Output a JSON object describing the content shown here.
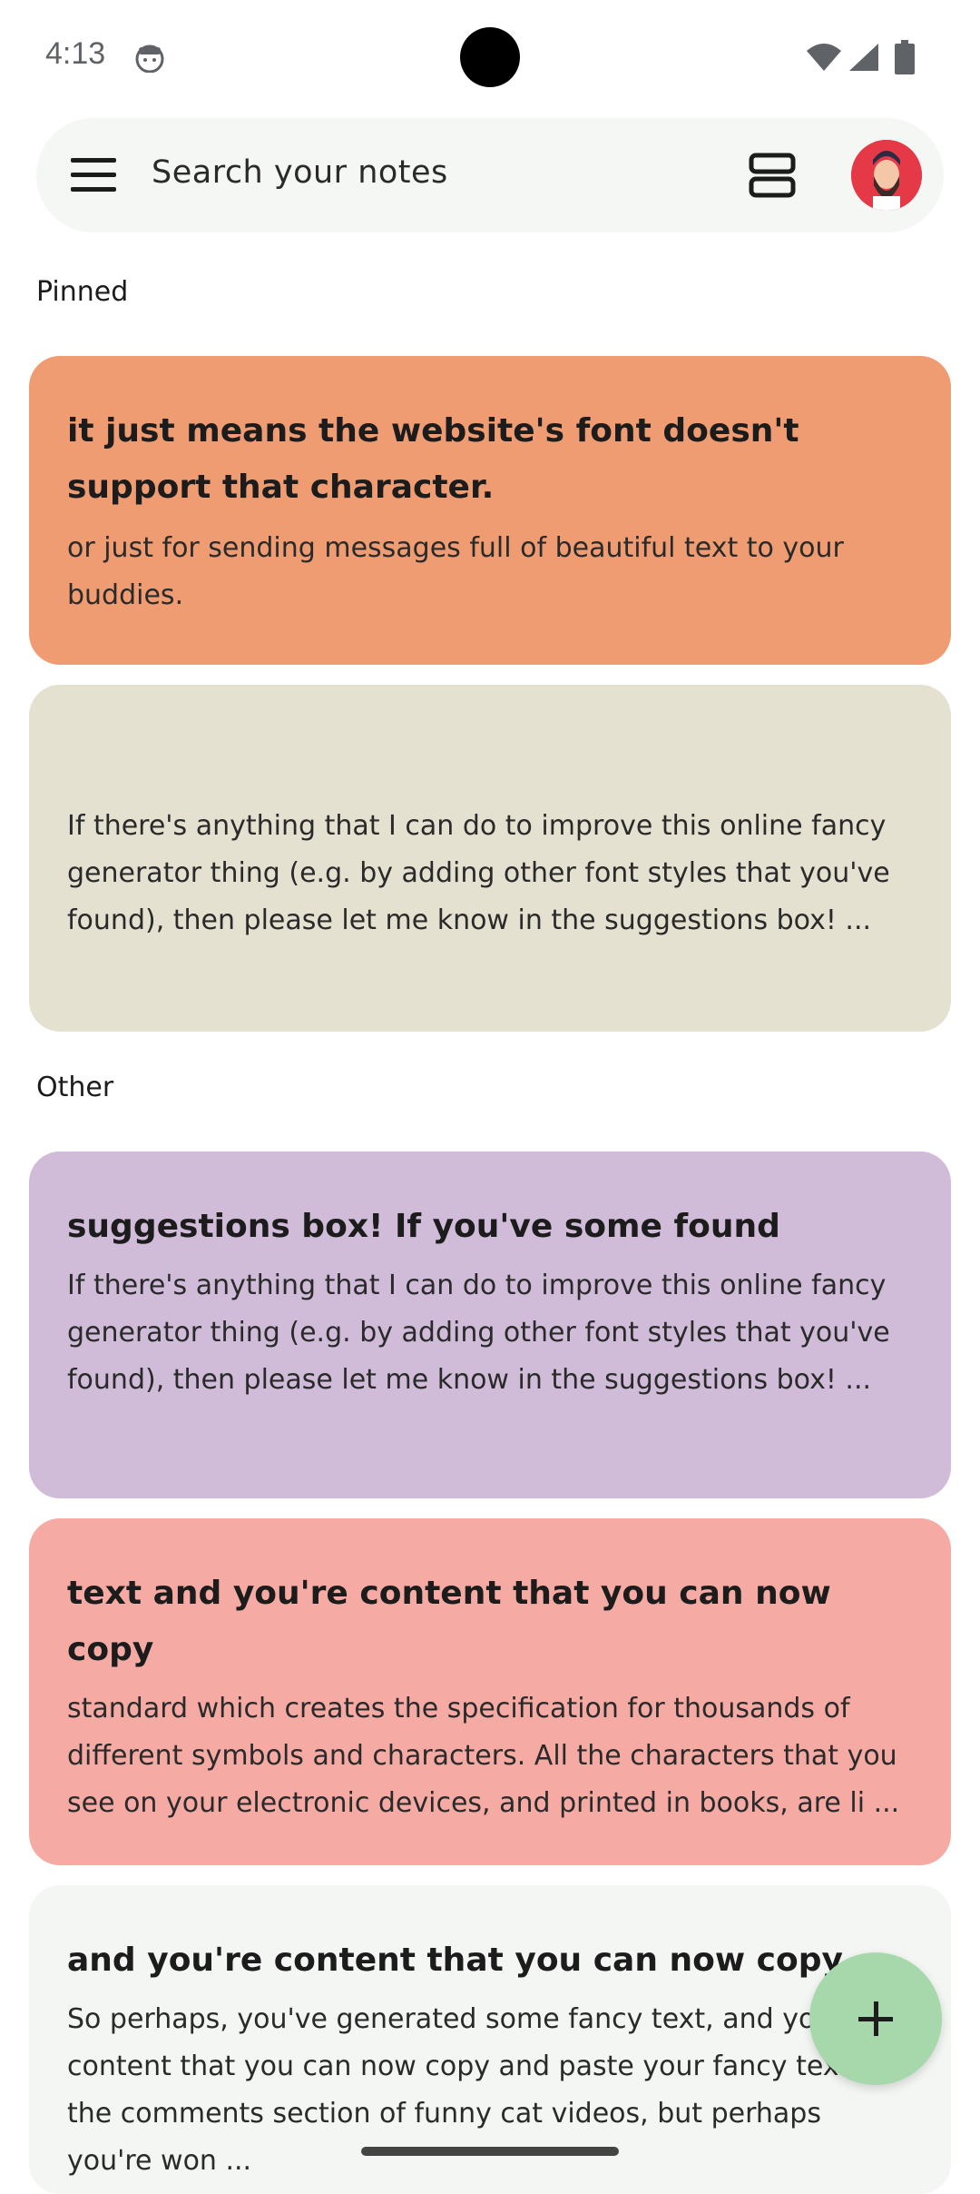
{
  "status_bar": {
    "time": "4:13",
    "icons": [
      "face-notification-icon",
      "wifi-icon",
      "signal-icon",
      "battery-icon"
    ]
  },
  "search": {
    "placeholder": "Search your notes",
    "icons": [
      "menu-icon",
      "view-toggle-icon",
      "avatar"
    ]
  },
  "sections": {
    "pinned_label": "Pinned",
    "other_label": "Other"
  },
  "notes": [
    {
      "title": "it just means the website's font doesn't support that character.",
      "body": "or just for sending messages full of beautiful text to your buddies.",
      "color": "#ef9c72"
    },
    {
      "title": "",
      "body": "If there's anything that I can do to improve this online fancy generator thing (e.g. by adding other font styles that you've found), then please let me know in the suggestions box! ...",
      "color": "#e5e1d1"
    },
    {
      "title": "suggestions box! If you've some found",
      "body": "If there's anything that I can do to improve this online fancy generator thing (e.g. by adding other font styles that you've found), then please let me know in the suggestions box! ...",
      "color": "#d0bcd9"
    },
    {
      "title": "text and you're content that you can now copy",
      "body": "standard which creates the specification for thousands of different symbols and characters. All the characters that you see on your electronic devices, and printed in books, are li ...",
      "color": "#f5aba3"
    },
    {
      "title": "and you're content that you can now copy",
      "body": "So perhaps, you've generated some fancy text, and you're content that you can now copy and paste your fancy text in the comments section of funny cat videos, but perhaps you're won ...",
      "color": "#f3f6f2"
    }
  ],
  "fab": {
    "icon": "plus-icon"
  }
}
